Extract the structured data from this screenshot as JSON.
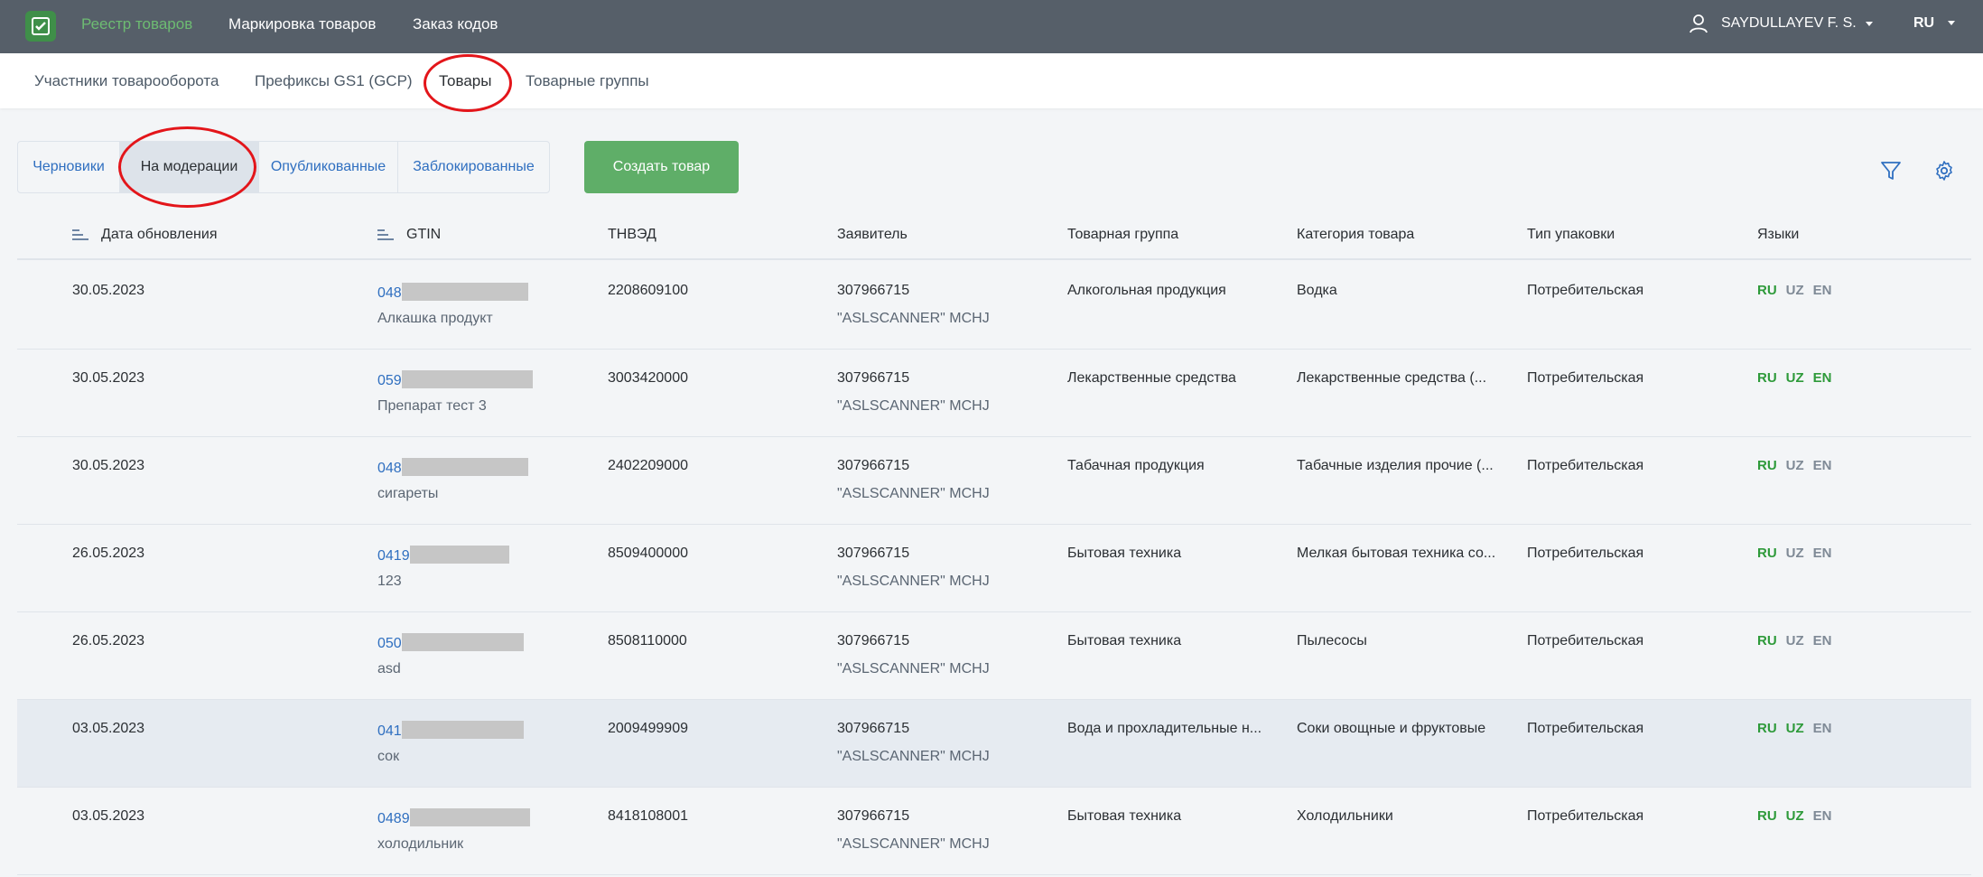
{
  "topbar": {
    "nav": [
      {
        "label": "Реестр товаров",
        "active": true
      },
      {
        "label": "Маркировка товаров",
        "active": false
      },
      {
        "label": "Заказ кодов",
        "active": false
      }
    ],
    "user": "SAYDULLAYEV F. S.",
    "language": "RU"
  },
  "subnav": {
    "items": [
      {
        "label": "Участники товарооборота",
        "active": false
      },
      {
        "label": "Префиксы GS1 (GCP)",
        "active": false
      },
      {
        "label": "Товары",
        "active": true
      },
      {
        "label": "Товарные группы",
        "active": false
      }
    ]
  },
  "status_tabs": {
    "items": [
      {
        "label": "Черновики",
        "active": false
      },
      {
        "label": "На модерации",
        "active": true
      },
      {
        "label": "Опубликованные",
        "active": false
      },
      {
        "label": "Заблокированные",
        "active": false
      }
    ]
  },
  "toolbar": {
    "create_label": "Создать товар",
    "filter_icon": "filter-icon",
    "settings_icon": "gear-icon"
  },
  "table": {
    "columns": [
      "Дата обновления",
      "GTIN",
      "ТНВЭД",
      "Заявитель",
      "Товарная группа",
      "Категория товара",
      "Тип упаковки",
      "Языки"
    ],
    "rows": [
      {
        "date": "30.05.2023",
        "gtin": "048",
        "name": "Алкашка продукт",
        "tnved": "2208609100",
        "applicant_id": "307966715",
        "applicant_name": "\"ASLSCANNER\" MCHJ",
        "group": "Алкогольная продукция",
        "category": "Водка",
        "package": "Потребительская",
        "langs": [
          {
            "code": "RU",
            "on": true
          },
          {
            "code": "UZ",
            "on": false
          },
          {
            "code": "EN",
            "on": false
          }
        ]
      },
      {
        "date": "30.05.2023",
        "gtin": "059",
        "name": "Препарат тест 3",
        "tnved": "3003420000",
        "applicant_id": "307966715",
        "applicant_name": "\"ASLSCANNER\" MCHJ",
        "group": "Лекарственные средства",
        "category": "Лекарственные средства (...",
        "package": "Потребительская",
        "langs": [
          {
            "code": "RU",
            "on": true
          },
          {
            "code": "UZ",
            "on": true
          },
          {
            "code": "EN",
            "on": true
          }
        ]
      },
      {
        "date": "30.05.2023",
        "gtin": "048",
        "name": "сигареты",
        "tnved": "2402209000",
        "applicant_id": "307966715",
        "applicant_name": "\"ASLSCANNER\" MCHJ",
        "group": "Табачная продукция",
        "category": "Табачные изделия прочие (...",
        "package": "Потребительская",
        "langs": [
          {
            "code": "RU",
            "on": true
          },
          {
            "code": "UZ",
            "on": false
          },
          {
            "code": "EN",
            "on": false
          }
        ]
      },
      {
        "date": "26.05.2023",
        "gtin": "0419",
        "name": "123",
        "tnved": "8509400000",
        "applicant_id": "307966715",
        "applicant_name": "\"ASLSCANNER\" MCHJ",
        "group": "Бытовая техника",
        "category": "Мелкая бытовая техника со...",
        "package": "Потребительская",
        "langs": [
          {
            "code": "RU",
            "on": true
          },
          {
            "code": "UZ",
            "on": false
          },
          {
            "code": "EN",
            "on": false
          }
        ]
      },
      {
        "date": "26.05.2023",
        "gtin": "050",
        "name": "asd",
        "tnved": "8508110000",
        "applicant_id": "307966715",
        "applicant_name": "\"ASLSCANNER\" MCHJ",
        "group": "Бытовая техника",
        "category": "Пылесосы",
        "package": "Потребительская",
        "langs": [
          {
            "code": "RU",
            "on": true
          },
          {
            "code": "UZ",
            "on": false
          },
          {
            "code": "EN",
            "on": false
          }
        ]
      },
      {
        "date": "03.05.2023",
        "gtin": "041",
        "name": "сок",
        "tnved": "2009499909",
        "applicant_id": "307966715",
        "applicant_name": "\"ASLSCANNER\" MCHJ",
        "group": "Вода и прохладительные н...",
        "category": "Соки овощные и фруктовые",
        "package": "Потребительская",
        "langs": [
          {
            "code": "RU",
            "on": true
          },
          {
            "code": "UZ",
            "on": true
          },
          {
            "code": "EN",
            "on": false
          }
        ]
      },
      {
        "date": "03.05.2023",
        "gtin": "0489",
        "name": "холодильник",
        "tnved": "8418108001",
        "applicant_id": "307966715",
        "applicant_name": "\"ASLSCANNER\" MCHJ",
        "group": "Бытовая техника",
        "category": "Холодильники",
        "package": "Потребительская",
        "langs": [
          {
            "code": "RU",
            "on": true
          },
          {
            "code": "UZ",
            "on": true
          },
          {
            "code": "EN",
            "on": false
          }
        ]
      }
    ],
    "highlighted_row": 6
  }
}
